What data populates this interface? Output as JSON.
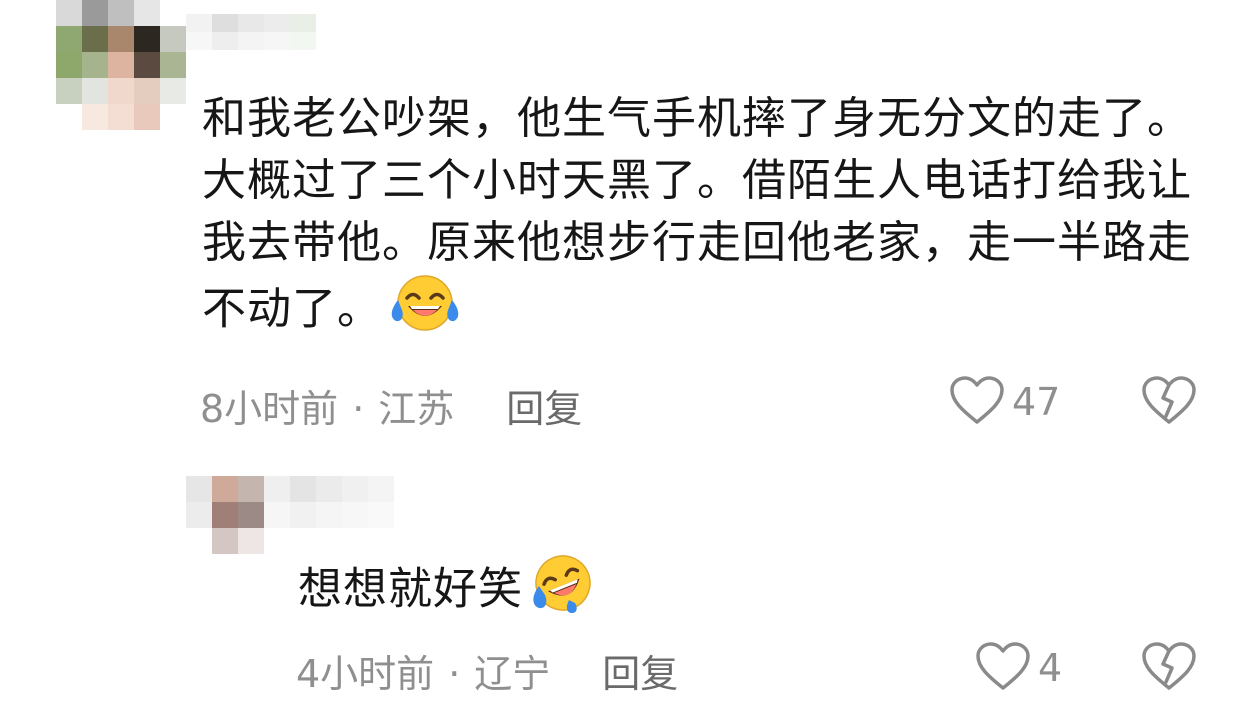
{
  "comments": [
    {
      "text": "和我老公吵架，他生气手机摔了身无分文的走了。大概过了三个小时天黑了。借陌生人电话打给我让我去带他。原来他想步行走回他老家，走一半路走不动了。",
      "emoji": "face-with-tears-of-joy",
      "time": "8小时前",
      "separator": "·",
      "location": "江苏",
      "reply_label": "回复",
      "likes": "47"
    },
    {
      "text": "想想就好笑",
      "emoji": "rolling-on-the-floor-laughing",
      "time": "4小时前",
      "separator": "·",
      "location": "辽宁",
      "reply_label": "回复",
      "likes": "4"
    }
  ],
  "icons": {
    "like": "heart-outline-icon",
    "dislike": "broken-heart-icon"
  },
  "colors": {
    "text": "#161616",
    "meta": "#8f8f8f",
    "icon": "#8a8a8a",
    "emoji_face": "#ffcc33",
    "emoji_tear": "#3b8bea"
  }
}
